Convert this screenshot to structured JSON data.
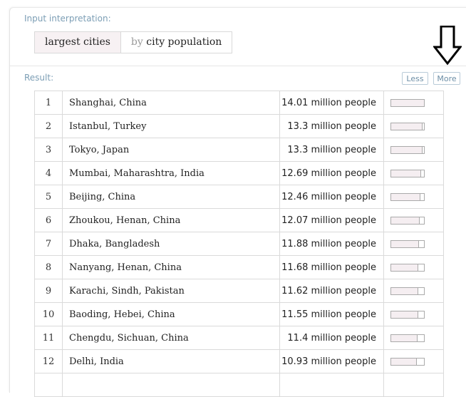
{
  "input": {
    "label": "Input interpretation:",
    "query": "largest cities",
    "qualifier_prefix": "by",
    "qualifier": "city population"
  },
  "result": {
    "label": "Result:",
    "less_label": "Less",
    "more_label": "More"
  },
  "rows": [
    {
      "rank": "1",
      "city": "Shanghai, China",
      "population": "14.01 million people",
      "fraction": 1.0
    },
    {
      "rank": "2",
      "city": "Istanbul, Turkey",
      "population": "13.3 million people",
      "fraction": 0.949
    },
    {
      "rank": "3",
      "city": "Tokyo, Japan",
      "population": "13.3 million people",
      "fraction": 0.949
    },
    {
      "rank": "4",
      "city": "Mumbai, Maharashtra, India",
      "population": "12.69 million people",
      "fraction": 0.906
    },
    {
      "rank": "5",
      "city": "Beijing, China",
      "population": "12.46 million people",
      "fraction": 0.889
    },
    {
      "rank": "6",
      "city": "Zhoukou, Henan, China",
      "population": "12.07 million people",
      "fraction": 0.862
    },
    {
      "rank": "7",
      "city": "Dhaka, Bangladesh",
      "population": "11.88 million people",
      "fraction": 0.848
    },
    {
      "rank": "8",
      "city": "Nanyang, Henan, China",
      "population": "11.68 million people",
      "fraction": 0.834
    },
    {
      "rank": "9",
      "city": "Karachi, Sindh, Pakistan",
      "population": "11.62 million people",
      "fraction": 0.829
    },
    {
      "rank": "10",
      "city": "Baoding, Hebei, China",
      "population": "11.55 million people",
      "fraction": 0.824
    },
    {
      "rank": "11",
      "city": "Chengdu, Sichuan, China",
      "population": "11.4 million people",
      "fraction": 0.814
    },
    {
      "rank": "12",
      "city": "Delhi, India",
      "population": "10.93 million people",
      "fraction": 0.78
    },
    {
      "rank": "",
      "city": "",
      "population": "",
      "fraction": 0
    }
  ],
  "icons": {
    "annotation": "down-arrow-icon"
  },
  "colors": {
    "label_blue": "#7c9eb5",
    "button_border": "#b9cbd8",
    "query_bg": "#f7f1f3",
    "bar_fill": "#f5eef1"
  }
}
